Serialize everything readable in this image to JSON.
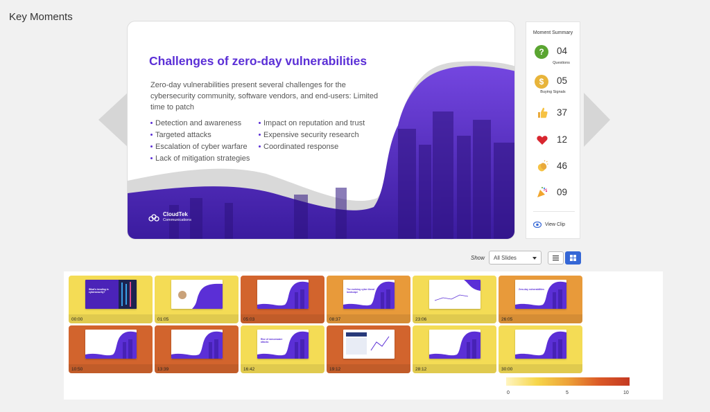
{
  "page_title": "Key Moments",
  "slide": {
    "title": "Challenges of zero-day vulnerabilities",
    "intro": "Zero-day vulnerabilities present several challenges for the cybersecurity community, software vendors, and end-users: Limited time to patch",
    "bullets_left": [
      "Detection and awareness",
      "Targeted attacks",
      "Escalation of cyber warfare",
      "Lack of mitigation strategies"
    ],
    "bullets_right": [
      "Impact on reputation and trust",
      "Expensive security research",
      "Coordinated response"
    ],
    "brand_name": "CloudTek",
    "brand_sub": "Communications"
  },
  "summary": {
    "title": "Moment Summary",
    "questions": {
      "value": "04",
      "label": "Questions",
      "icon": "question-icon",
      "color": "#5aa531"
    },
    "buying_signals": {
      "value": "05",
      "label": "Buying Signals",
      "icon": "dollar-icon",
      "color": "#e8b43a"
    },
    "thumbs_up": {
      "value": "37",
      "icon": "thumbs-up-emoji"
    },
    "heart": {
      "value": "12",
      "icon": "heart-emoji"
    },
    "clap": {
      "value": "46",
      "icon": "clap-emoji"
    },
    "party": {
      "value": "09",
      "icon": "party-popper-emoji"
    },
    "view_clip": "View Clip"
  },
  "controls": {
    "show_label": "Show",
    "filter_value": "All Slides"
  },
  "tiles": [
    {
      "time": "00:00",
      "intensity": 3,
      "text": "What's trending in cybersecurity?",
      "style": "dark"
    },
    {
      "time": "01:05",
      "intensity": 3,
      "text": "",
      "style": "speaker"
    },
    {
      "time": "05:03",
      "intensity": 8,
      "text": "",
      "style": "wave"
    },
    {
      "time": "08:37",
      "intensity": 6,
      "text": "The evolving cyber threat landscape",
      "style": "wave"
    },
    {
      "time": "23:06",
      "intensity": 3,
      "text": "",
      "style": "plain"
    },
    {
      "time": "26:05",
      "intensity": 6,
      "text": "Zero-day vulnerabilities",
      "style": "wave"
    },
    {
      "time": "10:50",
      "intensity": 8,
      "text": "",
      "style": "wave"
    },
    {
      "time": "13:39",
      "intensity": 8,
      "text": "",
      "style": "wave"
    },
    {
      "time": "16:42",
      "intensity": 3,
      "text": "Rise of ransomware attacks",
      "style": "wave"
    },
    {
      "time": "19:12",
      "intensity": 8,
      "text": "",
      "style": "table"
    },
    {
      "time": "28:12",
      "intensity": 3,
      "text": "",
      "style": "wave"
    },
    {
      "time": "30:00",
      "intensity": 3,
      "text": "",
      "style": "wave"
    }
  ],
  "legend": {
    "min": "0",
    "mid": "5",
    "max": "10"
  },
  "colors": {
    "accent": "#5b2fd6",
    "low": "#f4dc55",
    "mid": "#e89a3a",
    "high": "#d2642d"
  }
}
